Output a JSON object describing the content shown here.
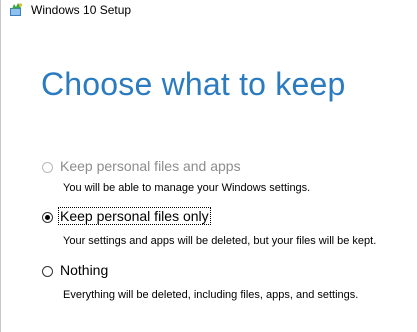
{
  "window": {
    "title": "Windows 10 Setup",
    "icon": "windows-setup-icon"
  },
  "page": {
    "title": "Choose what to keep",
    "title_color": "#2b7bc1"
  },
  "options": [
    {
      "label": "Keep personal files and apps",
      "description": "You will be able to manage your Windows settings.",
      "selected": false,
      "enabled": false
    },
    {
      "label": "Keep personal files only",
      "description": "Your settings and apps will be deleted, but your files will be kept.",
      "selected": true,
      "enabled": true
    },
    {
      "label": "Nothing",
      "description": "Everything will be deleted, including files, apps, and settings.",
      "selected": false,
      "enabled": true
    }
  ]
}
